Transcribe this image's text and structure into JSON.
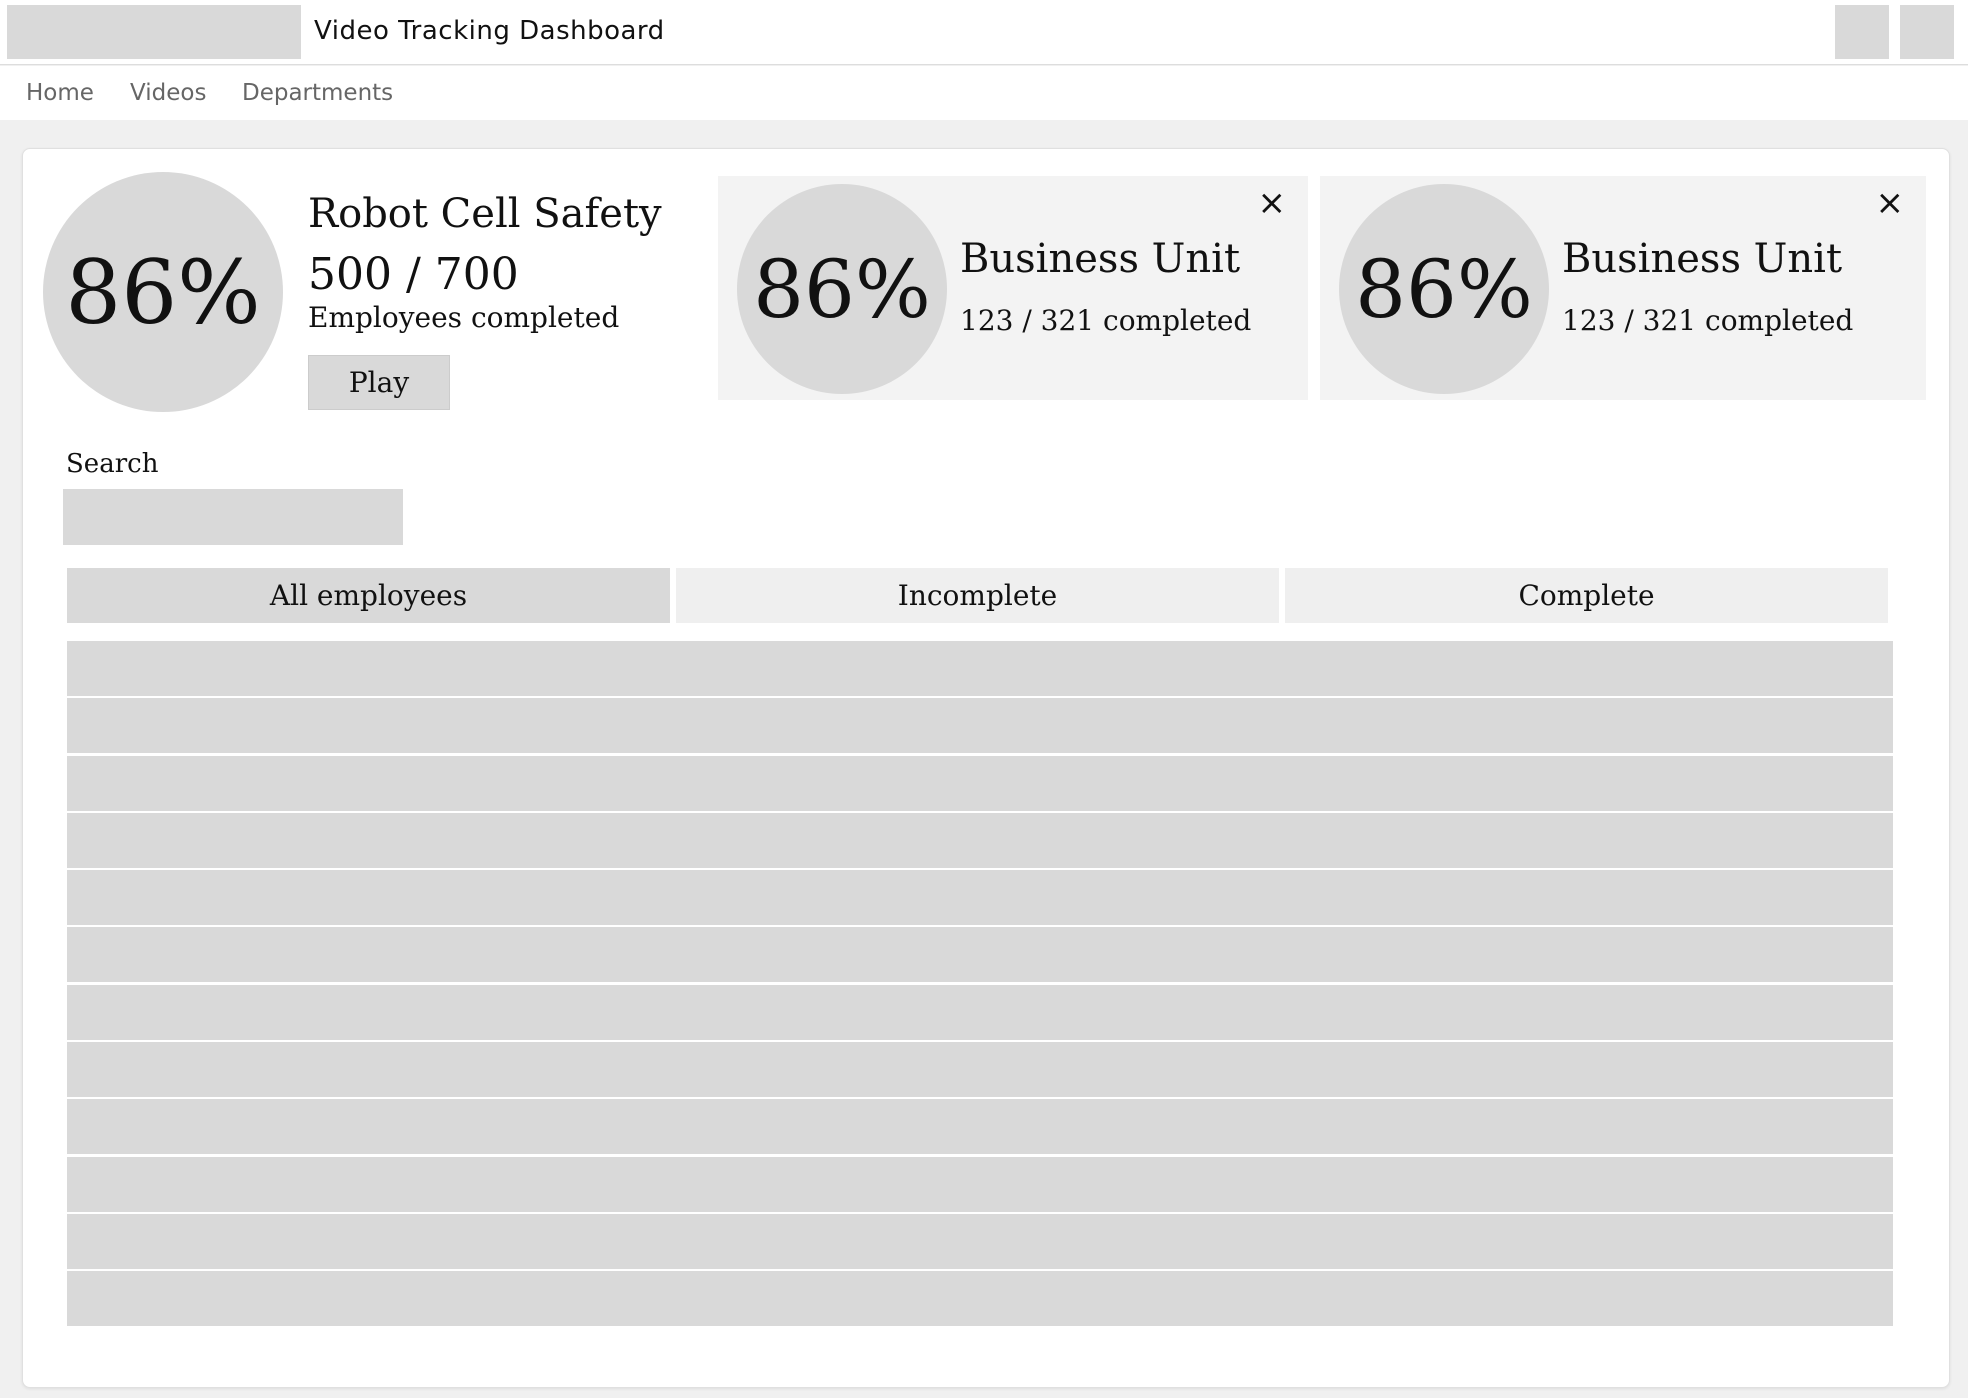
{
  "header": {
    "title": "Video Tracking Dashboard"
  },
  "nav": {
    "items": [
      "Home",
      "Videos",
      "Departments"
    ]
  },
  "summary": {
    "percent": "86%",
    "video_name": "Robot Cell Safety",
    "count": "500 / 700",
    "caption": "Employees completed",
    "play_label": "Play"
  },
  "business_units": [
    {
      "percent": "86%",
      "name": "Business Unit",
      "completed": "123 / 321 completed",
      "close": "×"
    },
    {
      "percent": "86%",
      "name": "Business Unit",
      "completed": "123 / 321 completed",
      "close": "×"
    }
  ],
  "search": {
    "label": "Search",
    "value": "",
    "placeholder": ""
  },
  "tabs": {
    "items": [
      "All employees",
      "Incomplete",
      "Complete"
    ],
    "selected": "All employees"
  },
  "table": {
    "rows": [
      {},
      {},
      {},
      {},
      {},
      {},
      {},
      {},
      {},
      {},
      {},
      {}
    ]
  },
  "colors": {
    "placeholder_gray": "#d9d9d9",
    "inactive_tab": "#efefef",
    "card_bg": "#f3f3f3",
    "page_bg": "#f0f0f0"
  }
}
